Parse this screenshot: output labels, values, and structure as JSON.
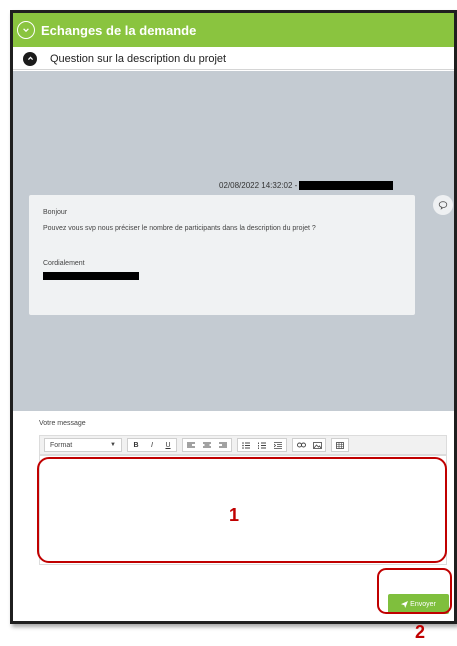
{
  "section": {
    "title": "Echanges de la demande"
  },
  "thread": {
    "subject": "Question sur la description du projet",
    "message": {
      "timestamp": "02/08/2022 14:32:02 -",
      "greeting": "Bonjour",
      "body": "Pouvez vous svp nous préciser le nombre de participants dans la description du projet ?",
      "closing": "Cordialement"
    }
  },
  "compose": {
    "label": "Votre message",
    "format_select": "Format",
    "toolbar": [
      "B",
      "I",
      "U"
    ],
    "send_label": "Envoyer"
  },
  "annotations": {
    "editor": "1",
    "send": "2"
  },
  "colors": {
    "accent_green": "#8ac43f",
    "highlight_red": "#c00000"
  }
}
